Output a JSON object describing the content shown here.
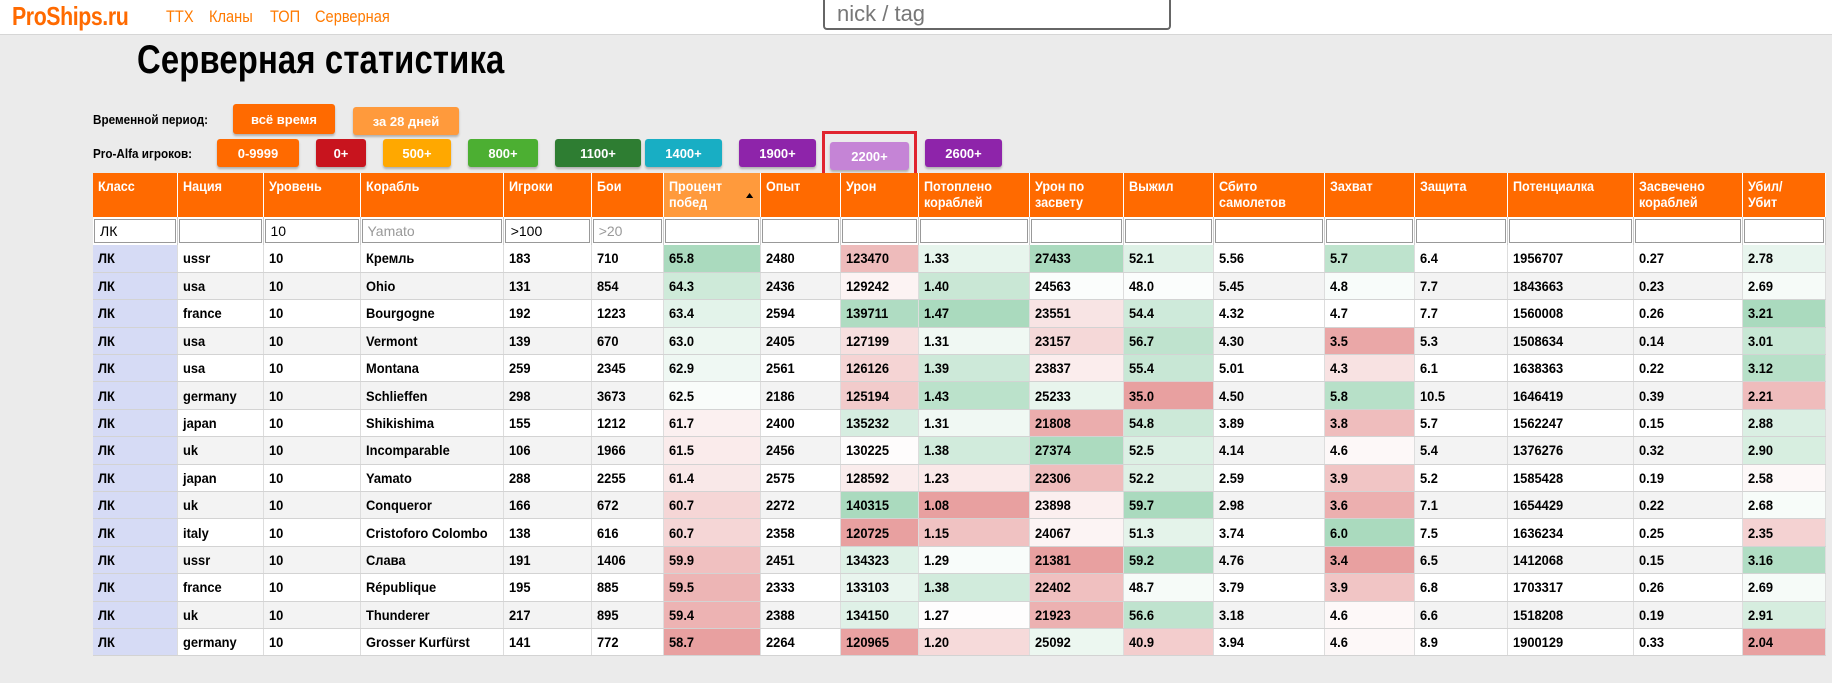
{
  "header": {
    "logo": "ProShips.ru",
    "nav": [
      "ТТХ",
      "Кланы",
      "ТОП",
      "Серверная"
    ],
    "search_placeholder": "nick / tag"
  },
  "page_title": "Серверная статистика",
  "period": {
    "label": "Временной период:",
    "options": [
      {
        "label": "всё время",
        "color": "#ff6a00"
      },
      {
        "label": "за 28 дней",
        "color": "#ff9a3c"
      }
    ]
  },
  "pro_alfa": {
    "label": "Pro-Alfa игроков:",
    "options": [
      {
        "label": "0-9999",
        "color": "#ff6a00"
      },
      {
        "label": "0+",
        "color": "#c8141e"
      },
      {
        "label": "500+",
        "color": "#ffa800"
      },
      {
        "label": "800+",
        "color": "#4caf32"
      },
      {
        "label": "1100+",
        "color": "#2e7d32"
      },
      {
        "label": "1400+",
        "color": "#18aec4"
      },
      {
        "label": "1900+",
        "color": "#8e24aa"
      },
      {
        "label": "2200+",
        "color": "#c584d6",
        "selected": true
      },
      {
        "label": "2600+",
        "color": "#8e24aa"
      }
    ]
  },
  "table": {
    "columns": [
      "Класс",
      "Нация",
      "Уровень",
      "Корабль",
      "Игроки",
      "Бои",
      "Процент побед",
      "Опыт",
      "Урон",
      "Потоплено кораблей",
      "Урон по засвету",
      "Выжил",
      "Сбито самолетов",
      "Захват",
      "Защита",
      "Потенциалка",
      "Засвечено кораблей",
      "Убил/ Убит"
    ],
    "sorted_column": 6,
    "filters": {
      "values": [
        "ЛК",
        "",
        "10",
        "",
        ">100",
        "",
        "",
        "",
        "",
        "",
        "",
        "",
        "",
        "",
        "",
        "",
        "",
        ""
      ],
      "placeholders": [
        "",
        "",
        "",
        "Yamato",
        "",
        ">20",
        "",
        "",
        "",
        "",
        "",
        "",
        "",
        "",
        "",
        "",
        "",
        ""
      ]
    },
    "rows": [
      [
        "ЛК",
        "ussr",
        "10",
        "Кремль",
        "183",
        "710",
        "65.8",
        "2480",
        "123470",
        "1.33",
        "27433",
        "52.1",
        "5.56",
        "5.7",
        "6.4",
        "1956707",
        "0.27",
        "2.78"
      ],
      [
        "ЛК",
        "usa",
        "10",
        "Ohio",
        "131",
        "854",
        "64.3",
        "2436",
        "129242",
        "1.40",
        "24563",
        "48.0",
        "5.45",
        "4.8",
        "7.7",
        "1843663",
        "0.23",
        "2.69"
      ],
      [
        "ЛК",
        "france",
        "10",
        "Bourgogne",
        "192",
        "1223",
        "63.4",
        "2594",
        "139711",
        "1.47",
        "23551",
        "54.4",
        "4.32",
        "4.7",
        "7.7",
        "1560008",
        "0.26",
        "3.21"
      ],
      [
        "ЛК",
        "usa",
        "10",
        "Vermont",
        "139",
        "670",
        "63.0",
        "2405",
        "127199",
        "1.31",
        "23157",
        "56.7",
        "4.30",
        "3.5",
        "5.3",
        "1508634",
        "0.14",
        "3.01"
      ],
      [
        "ЛК",
        "usa",
        "10",
        "Montana",
        "259",
        "2345",
        "62.9",
        "2561",
        "126126",
        "1.39",
        "23837",
        "55.4",
        "5.01",
        "4.3",
        "6.1",
        "1638363",
        "0.22",
        "3.12"
      ],
      [
        "ЛК",
        "germany",
        "10",
        "Schlieffen",
        "298",
        "3673",
        "62.5",
        "2186",
        "125194",
        "1.43",
        "25233",
        "35.0",
        "4.50",
        "5.8",
        "10.5",
        "1646419",
        "0.39",
        "2.21"
      ],
      [
        "ЛК",
        "japan",
        "10",
        "Shikishima",
        "155",
        "1212",
        "61.7",
        "2400",
        "135232",
        "1.31",
        "21808",
        "54.8",
        "3.89",
        "3.8",
        "5.7",
        "1562247",
        "0.15",
        "2.88"
      ],
      [
        "ЛК",
        "uk",
        "10",
        "Incomparable",
        "106",
        "1966",
        "61.5",
        "2456",
        "130225",
        "1.38",
        "27374",
        "52.5",
        "4.14",
        "4.6",
        "5.4",
        "1376276",
        "0.32",
        "2.90"
      ],
      [
        "ЛК",
        "japan",
        "10",
        "Yamato",
        "288",
        "2255",
        "61.4",
        "2575",
        "128592",
        "1.23",
        "22306",
        "52.2",
        "2.59",
        "3.9",
        "5.2",
        "1585428",
        "0.19",
        "2.58"
      ],
      [
        "ЛК",
        "uk",
        "10",
        "Conqueror",
        "166",
        "672",
        "60.7",
        "2272",
        "140315",
        "1.08",
        "23898",
        "59.7",
        "2.98",
        "3.6",
        "7.1",
        "1654429",
        "0.22",
        "2.68"
      ],
      [
        "ЛК",
        "italy",
        "10",
        "Cristoforo Colombo",
        "138",
        "616",
        "60.7",
        "2358",
        "120725",
        "1.15",
        "24067",
        "51.3",
        "3.74",
        "6.0",
        "7.5",
        "1636234",
        "0.25",
        "2.35"
      ],
      [
        "ЛК",
        "ussr",
        "10",
        "Слава",
        "191",
        "1406",
        "59.9",
        "2451",
        "134323",
        "1.29",
        "21381",
        "59.2",
        "4.76",
        "3.4",
        "6.5",
        "1412068",
        "0.15",
        "3.16"
      ],
      [
        "ЛК",
        "france",
        "10",
        "République",
        "195",
        "885",
        "59.5",
        "2333",
        "133103",
        "1.38",
        "22402",
        "48.7",
        "3.79",
        "3.9",
        "6.8",
        "1703317",
        "0.26",
        "2.69"
      ],
      [
        "ЛК",
        "uk",
        "10",
        "Thunderer",
        "217",
        "895",
        "59.4",
        "2388",
        "134150",
        "1.27",
        "21923",
        "56.6",
        "3.18",
        "4.6",
        "6.6",
        "1518208",
        "0.19",
        "2.91"
      ],
      [
        "ЛК",
        "germany",
        "10",
        "Grosser Kurfürst",
        "141",
        "772",
        "58.7",
        "2264",
        "120965",
        "1.20",
        "25092",
        "40.9",
        "3.94",
        "4.6",
        "8.9",
        "1900129",
        "0.33",
        "2.04"
      ]
    ]
  }
}
